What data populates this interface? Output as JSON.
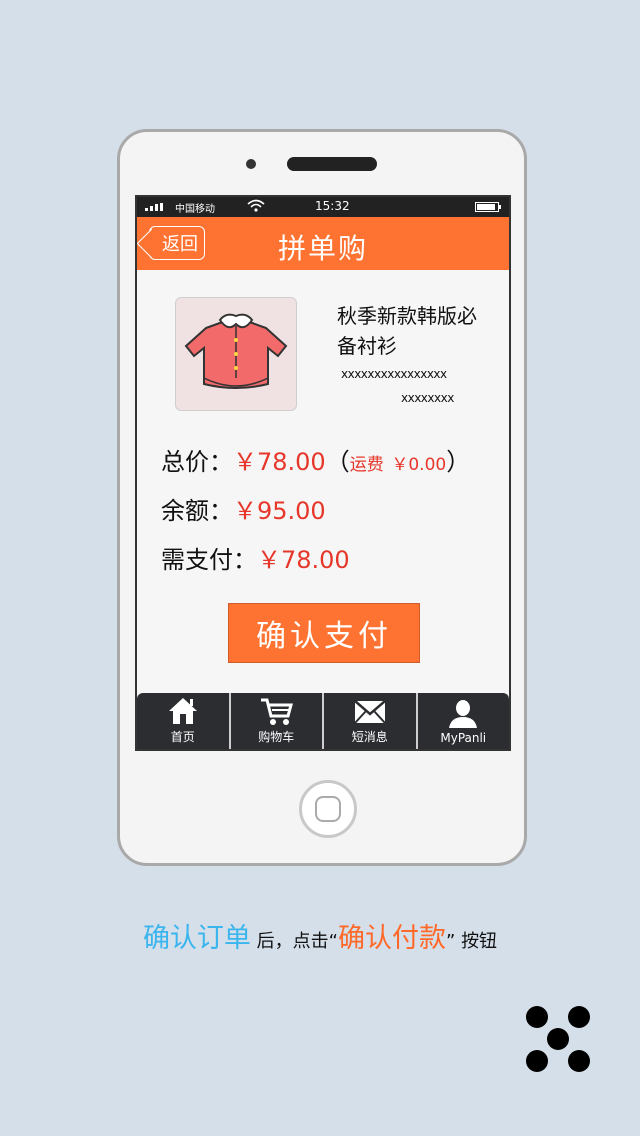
{
  "statusbar": {
    "carrier": "中国移动",
    "time": "15:32"
  },
  "navbar": {
    "back_label": "返回",
    "title": "拼单购"
  },
  "product": {
    "name": "秋季新款韩版必备衬衫",
    "code_line1": "xxxxxxxxxxxxxxxx",
    "code_line2": "xxxxxxxx"
  },
  "order": {
    "total_label": "总价：",
    "total_value": "￥78.00",
    "shipping_open": "（",
    "shipping_label": "运费",
    "shipping_value": "￥0.00",
    "shipping_close": "）",
    "balance_label": "余额：",
    "balance_value": "￥95.00",
    "due_label": "需支付：",
    "due_value": "￥78.00"
  },
  "pay_button": "确认支付",
  "tabbar": {
    "items": [
      {
        "label": "首页",
        "icon": "home-icon"
      },
      {
        "label": "购物车",
        "icon": "cart-icon"
      },
      {
        "label": "短消息",
        "icon": "mail-icon"
      },
      {
        "label": "MyPanli",
        "icon": "user-icon"
      }
    ]
  },
  "caption": {
    "part1": "确认订单",
    "part2": "后，点击",
    "part3": "“",
    "part4": "确认付款",
    "part5": "”",
    "part6": "按钮"
  },
  "colors": {
    "accent": "#ff7332",
    "price": "#e7372b",
    "caption_blue": "#3bb5ee",
    "caption_orange": "#ff6a2a"
  }
}
